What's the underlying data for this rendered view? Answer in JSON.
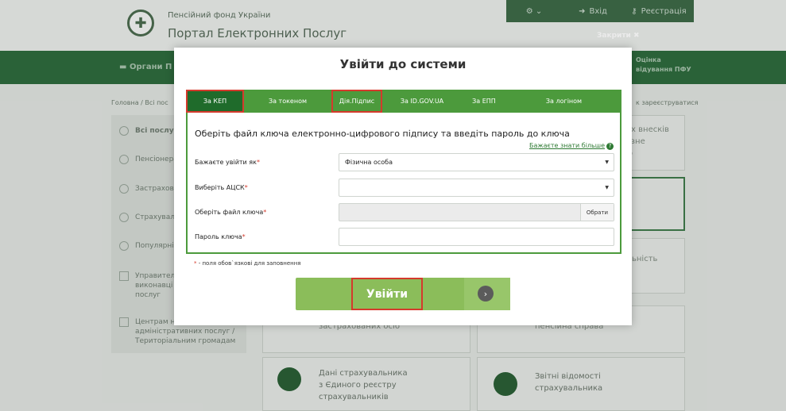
{
  "header": {
    "org_small": "Пенсійний фонд України",
    "portal_title": "Портал Електронних Послуг",
    "top_buttons": {
      "accessibility": "⚙ ⌄",
      "login": "Вхід",
      "register": "Реєстрація"
    },
    "close_label": "Закрити ✖"
  },
  "nav": {
    "left_item": "Органи П",
    "right_item_line1": "Оцінка",
    "right_item_line2": "відування ПФУ"
  },
  "breadcrumbs": {
    "left": "Головна / Всі пос",
    "right": "к зареєструватися"
  },
  "sidebar": {
    "items": [
      {
        "label": "Всі послуги"
      },
      {
        "label": "Пенсіонера"
      },
      {
        "label": "Застрахова"
      },
      {
        "label": "Страхувальн"
      },
      {
        "label": "Популярні"
      },
      {
        "label": "Управителі виконавці послуг"
      },
      {
        "label": "Центрам н адміністративних послуг / Територіальним громадам"
      }
    ]
  },
  "cards_bg": {
    "top_right_text": "них внесків\nкавне\nвір",
    "mid_right_text": "ьність",
    "bottom_mid_text": "застрахованих осіб",
    "bottom_right_text": "пенсійна справа",
    "card1_text": "Дані страхувальника\nз Єдиного реєстру\nстрахувальників",
    "card2_text": "Звітні відомості\nстрахувальника"
  },
  "modal": {
    "title": "Увійти до системи",
    "tabs": [
      {
        "label": "За КЕП"
      },
      {
        "label": "За токеном"
      },
      {
        "label": "Дія.Підпис"
      },
      {
        "label": "За ID.GOV.UA"
      },
      {
        "label": "За ЕПП"
      },
      {
        "label": "За логіном"
      }
    ],
    "heading": "Оберіть файл ключа електронно-цифрового підпису та введіть пароль до ключа",
    "more_link": "Бажаєте знати більше",
    "fields": {
      "login_as_label": "Бажаєте увійти як",
      "login_as_value": "Фізична особа",
      "acsk_label": "Виберіть АЦСК",
      "acsk_value": "",
      "key_file_label": "Оберіть файл ключа",
      "browse_label": "Обрати",
      "password_label": "Пароль ключа",
      "password_value": ""
    },
    "required_note": "- поля обов`язкові для заповнення",
    "submit_label": "Увійти"
  },
  "colors": {
    "tab_bar": "#4c9a3c",
    "tab_active": "#1f6b2b",
    "highlight_red": "#d43a2c",
    "submit_green": "#8bbd5a"
  }
}
